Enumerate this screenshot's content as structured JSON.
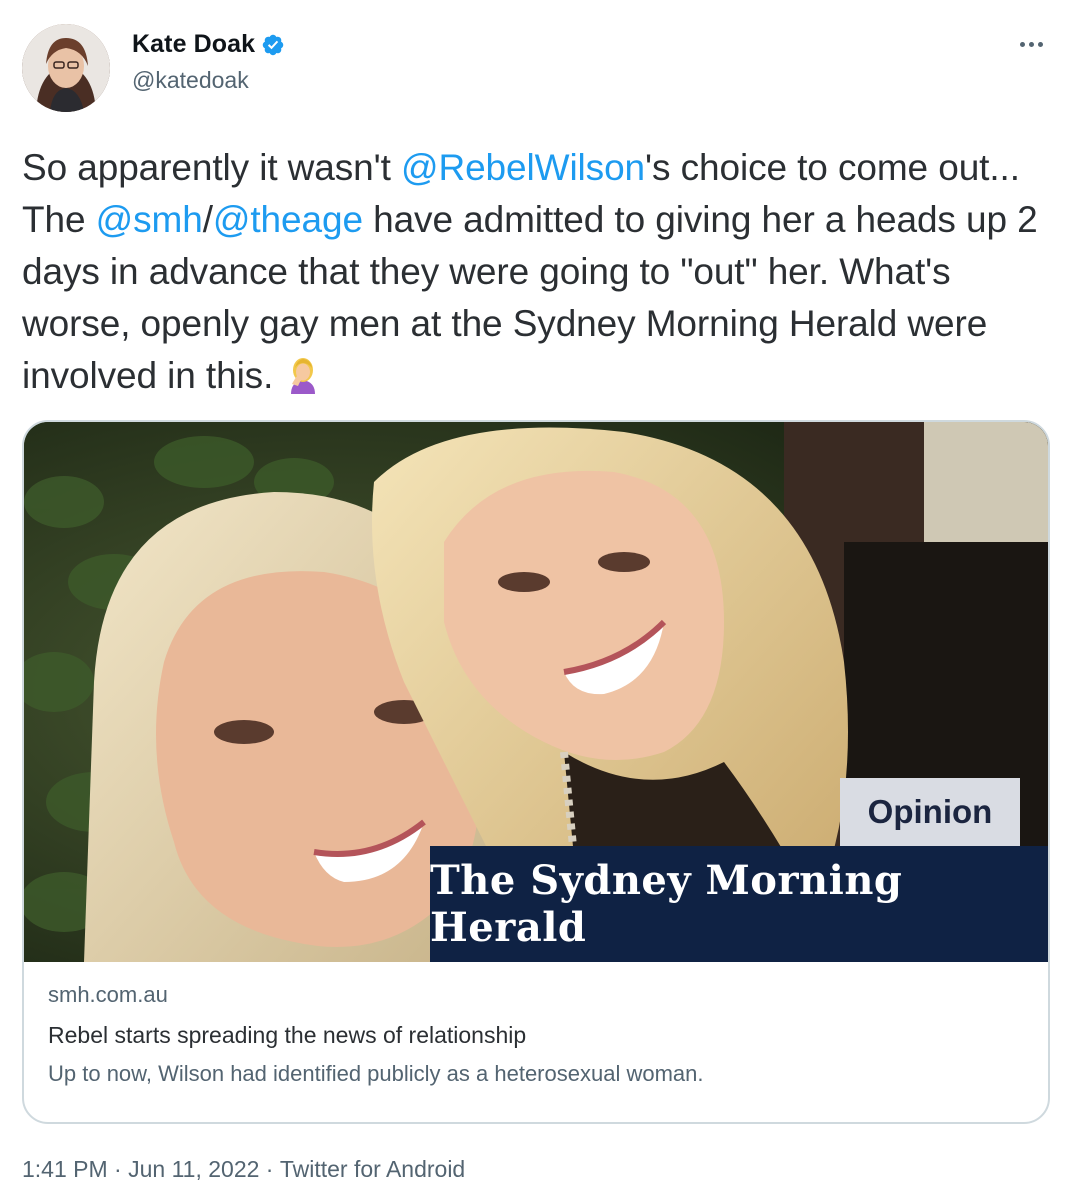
{
  "author": {
    "display_name": "Kate Doak",
    "handle": "@katedoak",
    "verified": true
  },
  "icons": {
    "verified": "verified-badge-icon",
    "more": "more-options-icon",
    "emoji": "woman-facepalming-emoji"
  },
  "tweet": {
    "text_1": "So apparently it wasn't ",
    "mention_1": "@RebelWilson",
    "text_2": "'s choice to come out... The ",
    "mention_2": "@smh",
    "text_3": "/",
    "mention_3": "@theage",
    "text_4": "  have admitted to giving her a heads up 2 days in advance that they were going to \"out\" her. What's worse, openly gay men at the Sydney Morning Herald were involved in this. "
  },
  "card": {
    "opinion_label": "Opinion",
    "masthead": "The Sydney Morning Herald",
    "domain": "smh.com.au",
    "title": "Rebel starts spreading the news of relationship",
    "description": "Up to now, Wilson had identified publicly as a heterosexual woman."
  },
  "footer": {
    "time": "1:41 PM",
    "sep1": " · ",
    "date": "Jun 11, 2022",
    "sep2": " · ",
    "source": "Twitter for Android"
  },
  "colors": {
    "link": "#1d9bf0",
    "verified": "#1d9bf0",
    "masthead_bg": "#0f2244",
    "secondary_text": "#536471"
  }
}
